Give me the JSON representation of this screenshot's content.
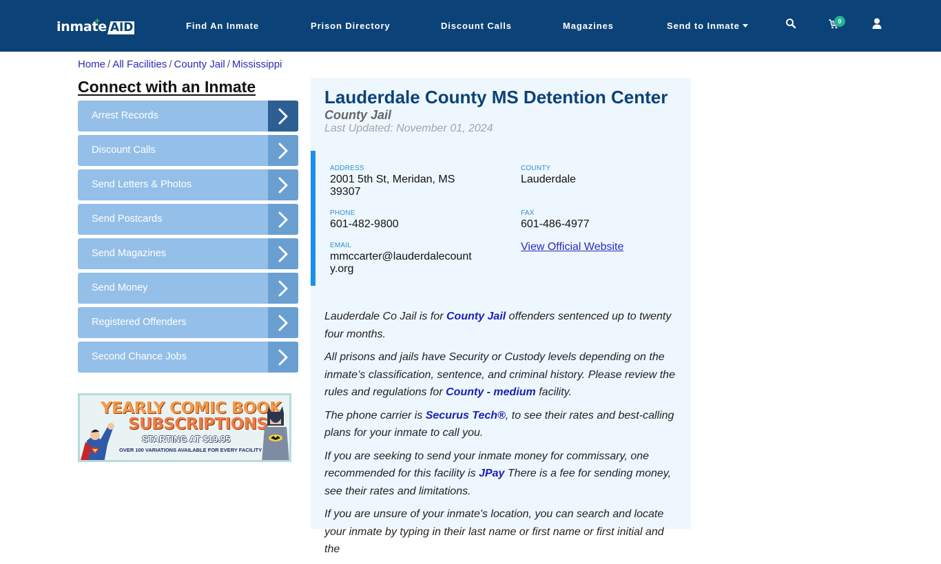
{
  "brand": {
    "logo_main": "inmate",
    "logo_accent": "AID",
    "logo_plus": "+"
  },
  "nav": {
    "items": [
      {
        "label": "Find An Inmate"
      },
      {
        "label": "Prison Directory"
      },
      {
        "label": "Discount Calls"
      },
      {
        "label": "Magazines"
      },
      {
        "label": "Send to Inmate",
        "has_dropdown": true
      }
    ],
    "icons": [
      "search-icon",
      "cart-icon",
      "user-icon"
    ],
    "cart_count": "0"
  },
  "breadcrumb": {
    "items": [
      "Home",
      "All Facilities",
      "County Jail",
      "Mississippi"
    ],
    "separator": "/"
  },
  "sidebar": {
    "title": "Connect with an Inmate",
    "items": [
      {
        "label": "Arrest Records",
        "active": true
      },
      {
        "label": "Discount Calls"
      },
      {
        "label": "Send Letters & Photos"
      },
      {
        "label": "Send Postcards"
      },
      {
        "label": "Send Magazines"
      },
      {
        "label": "Send Money"
      },
      {
        "label": "Registered Offenders"
      },
      {
        "label": "Second Chance Jobs"
      }
    ],
    "banner": {
      "line1": "YEARLY COMIC BOOK",
      "line2": "SUBSCRIPTIONS",
      "line3": "STARTING AT $19.95",
      "line4": "OVER 100 VARIATIONS AVAILABLE FOR EVERY FACILITY"
    }
  },
  "facility": {
    "title": "Lauderdale County MS Detention Center",
    "type": "County Jail",
    "last_updated": "Last Updated: November 01, 2024",
    "address_label": "Address",
    "address_line1": "2001 5th St, Meridan, MS",
    "address_line2": "39307",
    "county_label": "County",
    "county": "Lauderdale",
    "phone_label": "Phone",
    "phone": "601-482-9800",
    "fax_label": "Fax",
    "fax": "601-486-4977",
    "email_label": "Email",
    "email_line1": "mmccarter@lauderdalecount",
    "email_line2": "y.org",
    "website_link": "View Official Website"
  },
  "description": {
    "p1_a": "Lauderdale Co Jail is for ",
    "p1_link": "County Jail",
    "p1_b": " offenders sentenced up to twenty four months.",
    "p2_a": "All prisons and jails have Security or Custody levels depending on the inmate’s classification, sentence, and criminal history. Please review the rules and regulations for ",
    "p2_link": "County - medium",
    "p2_b": " facility.",
    "p3_a": "The phone carrier is ",
    "p3_link": "Securus Tech®",
    "p3_b": ", to see their rates and best-calling plans for your inmate to call you.",
    "p4_a": "If you are seeking to send your inmate money for commissary, one recommended for this facility is ",
    "p4_link": "JPay",
    "p4_b": " There is a fee for sending money, see their rates and limitations.",
    "p5_a": "If you are unsure of your inmate's location, you can search and locate your inmate by typing in their last name or first name or first initial and the"
  },
  "colors": {
    "navbar": "#0b4277",
    "accent_blue": "#1a8ee8",
    "sidebar_item": "#94bfe8",
    "sidebar_chevron": "#6a9fd2",
    "sidebar_chevron_active": "#2d5f93",
    "badge": "#22b396",
    "panel_bg": "#eef7fd"
  }
}
